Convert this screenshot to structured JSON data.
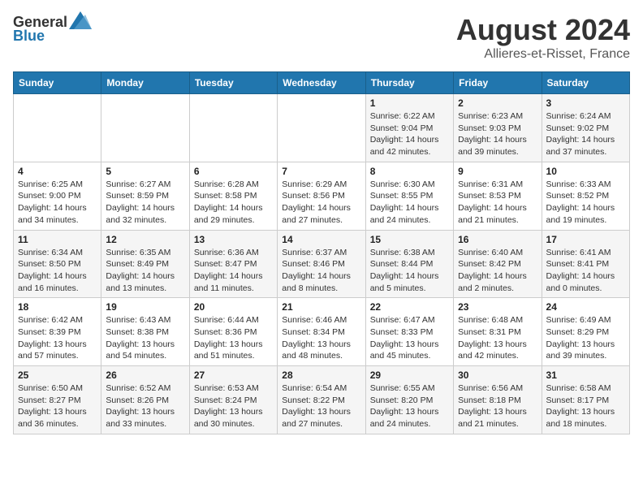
{
  "header": {
    "logo_general": "General",
    "logo_blue": "Blue",
    "month_year": "August 2024",
    "location": "Allieres-et-Risset, France"
  },
  "days_of_week": [
    "Sunday",
    "Monday",
    "Tuesday",
    "Wednesday",
    "Thursday",
    "Friday",
    "Saturday"
  ],
  "weeks": [
    [
      {
        "day": "",
        "info": ""
      },
      {
        "day": "",
        "info": ""
      },
      {
        "day": "",
        "info": ""
      },
      {
        "day": "",
        "info": ""
      },
      {
        "day": "1",
        "info": "Sunrise: 6:22 AM\nSunset: 9:04 PM\nDaylight: 14 hours and 42 minutes."
      },
      {
        "day": "2",
        "info": "Sunrise: 6:23 AM\nSunset: 9:03 PM\nDaylight: 14 hours and 39 minutes."
      },
      {
        "day": "3",
        "info": "Sunrise: 6:24 AM\nSunset: 9:02 PM\nDaylight: 14 hours and 37 minutes."
      }
    ],
    [
      {
        "day": "4",
        "info": "Sunrise: 6:25 AM\nSunset: 9:00 PM\nDaylight: 14 hours and 34 minutes."
      },
      {
        "day": "5",
        "info": "Sunrise: 6:27 AM\nSunset: 8:59 PM\nDaylight: 14 hours and 32 minutes."
      },
      {
        "day": "6",
        "info": "Sunrise: 6:28 AM\nSunset: 8:58 PM\nDaylight: 14 hours and 29 minutes."
      },
      {
        "day": "7",
        "info": "Sunrise: 6:29 AM\nSunset: 8:56 PM\nDaylight: 14 hours and 27 minutes."
      },
      {
        "day": "8",
        "info": "Sunrise: 6:30 AM\nSunset: 8:55 PM\nDaylight: 14 hours and 24 minutes."
      },
      {
        "day": "9",
        "info": "Sunrise: 6:31 AM\nSunset: 8:53 PM\nDaylight: 14 hours and 21 minutes."
      },
      {
        "day": "10",
        "info": "Sunrise: 6:33 AM\nSunset: 8:52 PM\nDaylight: 14 hours and 19 minutes."
      }
    ],
    [
      {
        "day": "11",
        "info": "Sunrise: 6:34 AM\nSunset: 8:50 PM\nDaylight: 14 hours and 16 minutes."
      },
      {
        "day": "12",
        "info": "Sunrise: 6:35 AM\nSunset: 8:49 PM\nDaylight: 14 hours and 13 minutes."
      },
      {
        "day": "13",
        "info": "Sunrise: 6:36 AM\nSunset: 8:47 PM\nDaylight: 14 hours and 11 minutes."
      },
      {
        "day": "14",
        "info": "Sunrise: 6:37 AM\nSunset: 8:46 PM\nDaylight: 14 hours and 8 minutes."
      },
      {
        "day": "15",
        "info": "Sunrise: 6:38 AM\nSunset: 8:44 PM\nDaylight: 14 hours and 5 minutes."
      },
      {
        "day": "16",
        "info": "Sunrise: 6:40 AM\nSunset: 8:42 PM\nDaylight: 14 hours and 2 minutes."
      },
      {
        "day": "17",
        "info": "Sunrise: 6:41 AM\nSunset: 8:41 PM\nDaylight: 14 hours and 0 minutes."
      }
    ],
    [
      {
        "day": "18",
        "info": "Sunrise: 6:42 AM\nSunset: 8:39 PM\nDaylight: 13 hours and 57 minutes."
      },
      {
        "day": "19",
        "info": "Sunrise: 6:43 AM\nSunset: 8:38 PM\nDaylight: 13 hours and 54 minutes."
      },
      {
        "day": "20",
        "info": "Sunrise: 6:44 AM\nSunset: 8:36 PM\nDaylight: 13 hours and 51 minutes."
      },
      {
        "day": "21",
        "info": "Sunrise: 6:46 AM\nSunset: 8:34 PM\nDaylight: 13 hours and 48 minutes."
      },
      {
        "day": "22",
        "info": "Sunrise: 6:47 AM\nSunset: 8:33 PM\nDaylight: 13 hours and 45 minutes."
      },
      {
        "day": "23",
        "info": "Sunrise: 6:48 AM\nSunset: 8:31 PM\nDaylight: 13 hours and 42 minutes."
      },
      {
        "day": "24",
        "info": "Sunrise: 6:49 AM\nSunset: 8:29 PM\nDaylight: 13 hours and 39 minutes."
      }
    ],
    [
      {
        "day": "25",
        "info": "Sunrise: 6:50 AM\nSunset: 8:27 PM\nDaylight: 13 hours and 36 minutes."
      },
      {
        "day": "26",
        "info": "Sunrise: 6:52 AM\nSunset: 8:26 PM\nDaylight: 13 hours and 33 minutes."
      },
      {
        "day": "27",
        "info": "Sunrise: 6:53 AM\nSunset: 8:24 PM\nDaylight: 13 hours and 30 minutes."
      },
      {
        "day": "28",
        "info": "Sunrise: 6:54 AM\nSunset: 8:22 PM\nDaylight: 13 hours and 27 minutes."
      },
      {
        "day": "29",
        "info": "Sunrise: 6:55 AM\nSunset: 8:20 PM\nDaylight: 13 hours and 24 minutes."
      },
      {
        "day": "30",
        "info": "Sunrise: 6:56 AM\nSunset: 8:18 PM\nDaylight: 13 hours and 21 minutes."
      },
      {
        "day": "31",
        "info": "Sunrise: 6:58 AM\nSunset: 8:17 PM\nDaylight: 13 hours and 18 minutes."
      }
    ]
  ]
}
